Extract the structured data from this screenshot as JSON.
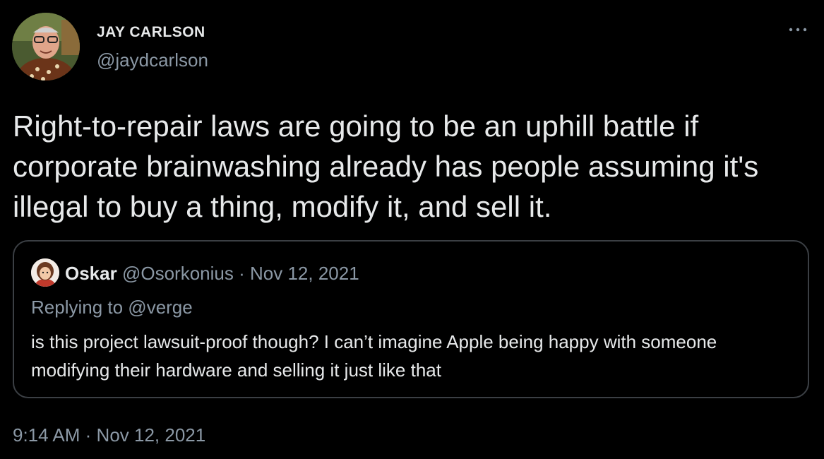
{
  "tweet": {
    "author": {
      "name": "JAY CARLSON",
      "handle": "@jaydcarlson"
    },
    "text": "Right-to-repair laws are going to be an uphill battle if corporate brainwashing already has people assuming it's illegal to buy a thing, modify it, and sell it.",
    "more_icon": "more-horizontal-icon",
    "timestamp": {
      "time": "9:14 AM",
      "separator": "·",
      "date": "Nov 12, 2021"
    }
  },
  "quoted_tweet": {
    "author": {
      "name": "Oskar",
      "handle": "@Osorkonius"
    },
    "separator": "·",
    "date": "Nov 12, 2021",
    "replying_to": "Replying to @verge",
    "text": "is this project lawsuit-proof though? I can’t imagine Apple being happy with someone modifying their hardware and selling it just like that"
  },
  "colors": {
    "background": "#000000",
    "primary_text": "#e7e9ea",
    "secondary_text": "#8b98a5",
    "quote_border": "#3b3f44"
  }
}
